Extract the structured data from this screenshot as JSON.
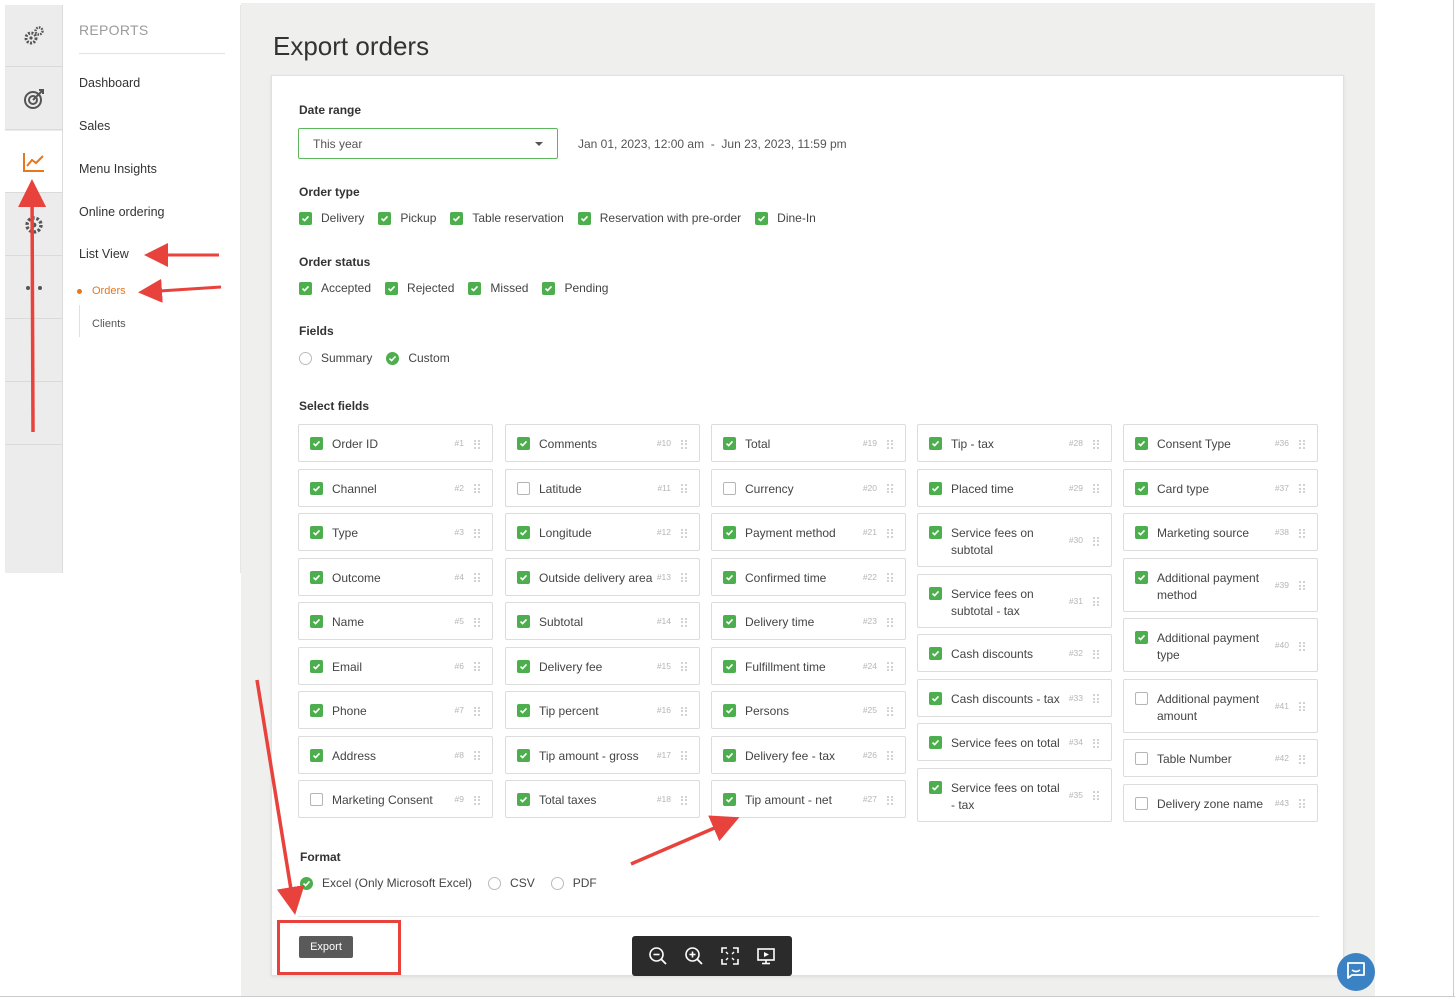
{
  "sidebar": {
    "title": "REPORTS",
    "items": [
      "Dashboard",
      "Sales",
      "Menu Insights",
      "Online ordering",
      "List View"
    ],
    "subitems": [
      "Orders",
      "Clients"
    ]
  },
  "rail": {
    "icons": [
      "gears-icon",
      "target-icon",
      "chart-line-icon",
      "star-gear-icon",
      "more-dots-icon"
    ]
  },
  "page": {
    "title": "Export orders"
  },
  "date_range": {
    "label": "Date range",
    "selected": "This year",
    "range_text": "Jan 01, 2023, 12:00 am  -  Jun 23, 2023, 11:59 pm"
  },
  "order_type": {
    "label": "Order type",
    "options": [
      {
        "label": "Delivery",
        "checked": true
      },
      {
        "label": "Pickup",
        "checked": true
      },
      {
        "label": "Table reservation",
        "checked": true
      },
      {
        "label": "Reservation with pre-order",
        "checked": true
      },
      {
        "label": "Dine-In",
        "checked": true
      }
    ]
  },
  "order_status": {
    "label": "Order status",
    "options": [
      {
        "label": "Accepted",
        "checked": true
      },
      {
        "label": "Rejected",
        "checked": true
      },
      {
        "label": "Missed",
        "checked": true
      },
      {
        "label": "Pending",
        "checked": true
      }
    ]
  },
  "fields_mode": {
    "label": "Fields",
    "options": [
      {
        "label": "Summary",
        "selected": false
      },
      {
        "label": "Custom",
        "selected": true
      }
    ]
  },
  "select_fields": {
    "label": "Select fields",
    "columns": [
      [
        {
          "label": "Order ID",
          "num": "#1",
          "checked": true
        },
        {
          "label": "Channel",
          "num": "#2",
          "checked": true
        },
        {
          "label": "Type",
          "num": "#3",
          "checked": true
        },
        {
          "label": "Outcome",
          "num": "#4",
          "checked": true
        },
        {
          "label": "Name",
          "num": "#5",
          "checked": true
        },
        {
          "label": "Email",
          "num": "#6",
          "checked": true
        },
        {
          "label": "Phone",
          "num": "#7",
          "checked": true
        },
        {
          "label": "Address",
          "num": "#8",
          "checked": true
        },
        {
          "label": "Marketing Consent",
          "num": "#9",
          "checked": false
        }
      ],
      [
        {
          "label": "Comments",
          "num": "#10",
          "checked": true
        },
        {
          "label": "Latitude",
          "num": "#11",
          "checked": false
        },
        {
          "label": "Longitude",
          "num": "#12",
          "checked": true
        },
        {
          "label": "Outside delivery area",
          "num": "#13",
          "checked": true
        },
        {
          "label": "Subtotal",
          "num": "#14",
          "checked": true
        },
        {
          "label": "Delivery fee",
          "num": "#15",
          "checked": true
        },
        {
          "label": "Tip percent",
          "num": "#16",
          "checked": true
        },
        {
          "label": "Tip amount - gross",
          "num": "#17",
          "checked": true
        },
        {
          "label": "Total taxes",
          "num": "#18",
          "checked": true
        }
      ],
      [
        {
          "label": "Total",
          "num": "#19",
          "checked": true
        },
        {
          "label": "Currency",
          "num": "#20",
          "checked": false
        },
        {
          "label": "Payment method",
          "num": "#21",
          "checked": true
        },
        {
          "label": "Confirmed time",
          "num": "#22",
          "checked": true
        },
        {
          "label": "Delivery time",
          "num": "#23",
          "checked": true
        },
        {
          "label": "Fulfillment time",
          "num": "#24",
          "checked": true
        },
        {
          "label": "Persons",
          "num": "#25",
          "checked": true
        },
        {
          "label": "Delivery fee - tax",
          "num": "#26",
          "checked": true
        },
        {
          "label": "Tip amount - net",
          "num": "#27",
          "checked": true
        }
      ],
      [
        {
          "label": "Tip - tax",
          "num": "#28",
          "checked": true
        },
        {
          "label": "Placed time",
          "num": "#29",
          "checked": true
        },
        {
          "label": "Service fees on subtotal",
          "num": "#30",
          "checked": true
        },
        {
          "label": "Service fees on subtotal - tax",
          "num": "#31",
          "checked": true
        },
        {
          "label": "Cash discounts",
          "num": "#32",
          "checked": true
        },
        {
          "label": "Cash discounts - tax",
          "num": "#33",
          "checked": true
        },
        {
          "label": "Service fees on total",
          "num": "#34",
          "checked": true
        },
        {
          "label": "Service fees on total - tax",
          "num": "#35",
          "checked": true
        }
      ],
      [
        {
          "label": "Consent Type",
          "num": "#36",
          "checked": true
        },
        {
          "label": "Card type",
          "num": "#37",
          "checked": true
        },
        {
          "label": "Marketing source",
          "num": "#38",
          "checked": true
        },
        {
          "label": "Additional payment method",
          "num": "#39",
          "checked": true
        },
        {
          "label": "Additional payment type",
          "num": "#40",
          "checked": true
        },
        {
          "label": "Additional payment amount",
          "num": "#41",
          "checked": false
        },
        {
          "label": "Table Number",
          "num": "#42",
          "checked": false
        },
        {
          "label": "Delivery zone name",
          "num": "#43",
          "checked": false
        }
      ]
    ]
  },
  "format": {
    "label": "Format",
    "options": [
      {
        "label": "Excel (Only Microsoft Excel)",
        "selected": true
      },
      {
        "label": "CSV",
        "selected": false
      },
      {
        "label": "PDF",
        "selected": false
      }
    ]
  },
  "export_label": "Export",
  "viewer_icons": [
    "zoom-out-icon",
    "zoom-in-icon",
    "fit-screen-icon",
    "present-icon"
  ],
  "colors": {
    "accent_green": "#4cae4c",
    "active_orange": "#e8761a",
    "annotation_red": "#e8423c"
  }
}
